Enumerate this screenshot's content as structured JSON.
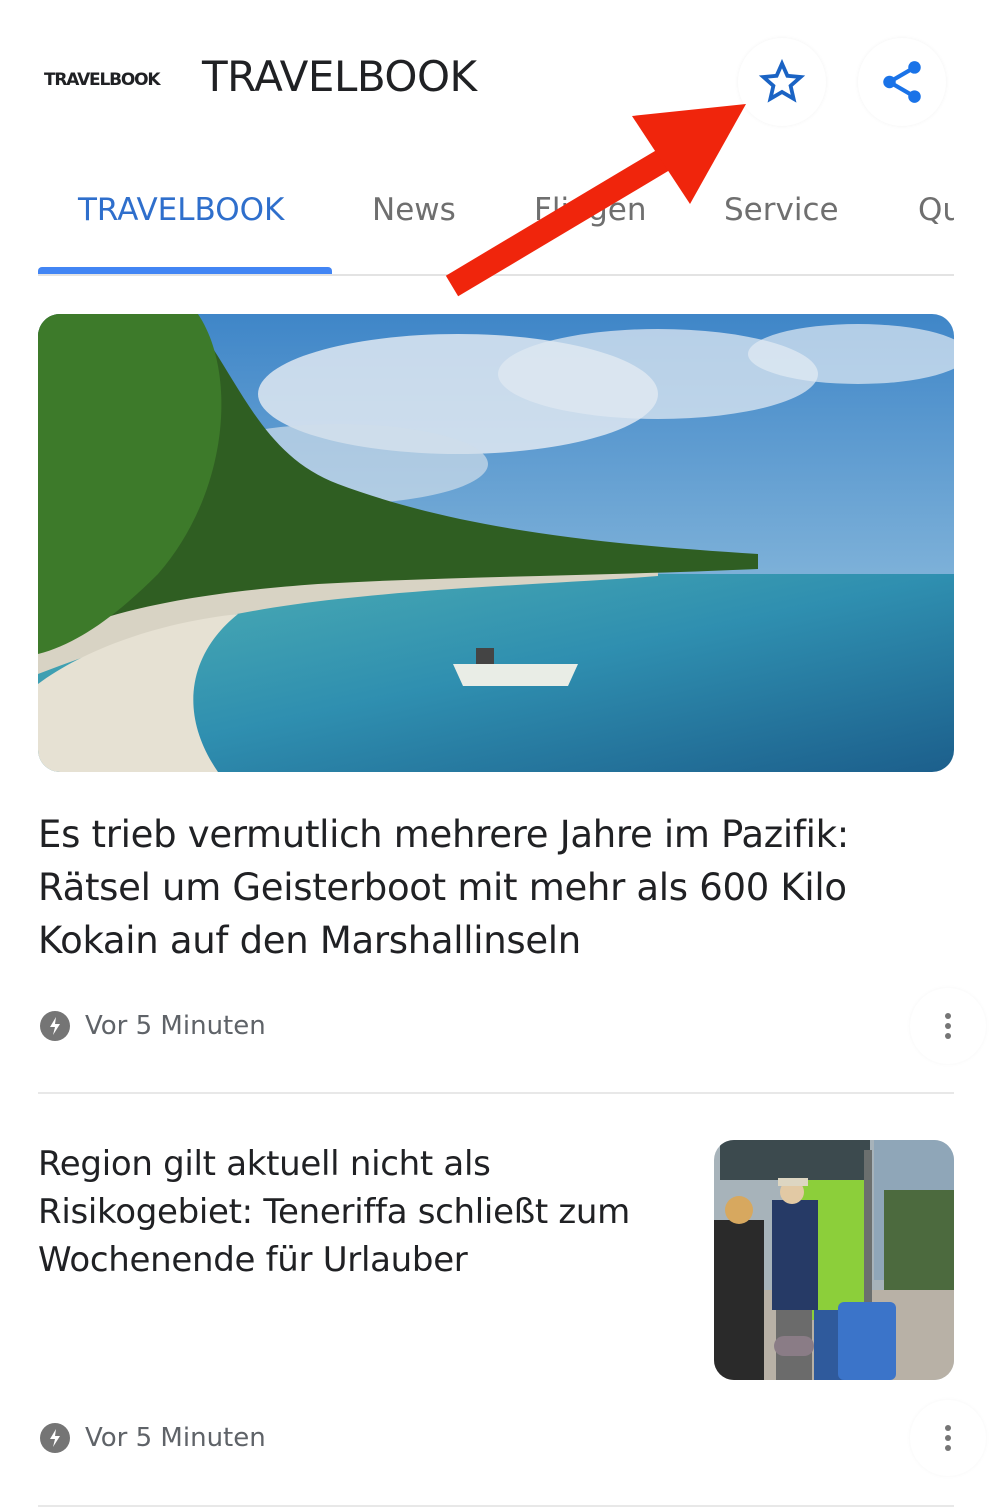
{
  "header": {
    "logo_text": "TRAVELBOOK",
    "title": "TRAVELBOOK",
    "star_icon": "star-outline-icon",
    "share_icon": "share-icon",
    "accent_color": "#1a73e8"
  },
  "tabs": [
    {
      "label": "TRAVELBOOK",
      "active": true
    },
    {
      "label": "News",
      "active": false
    },
    {
      "label": "Fliegen",
      "active": false
    },
    {
      "label": "Service",
      "active": false
    },
    {
      "label": "Qu",
      "active": false
    }
  ],
  "articles": [
    {
      "image": "beach-island-boat-image",
      "headline": "Es trieb vermutlich mehrere Jahre im Pazifik: Rätsel um Geisterboot mit mehr als 600 Kilo Kokain auf den Marshallinseln",
      "time": "Vor 5 Minuten",
      "time_icon": "bolt-icon",
      "more_icon": "more-vert-icon"
    },
    {
      "image": "travelers-luggage-ticket-booth-image",
      "headline": "Region gilt aktuell nicht als Risikogebiet: Teneriffa schließt zum Wochenende für Urlauber",
      "time": "Vor 5 Minuten",
      "time_icon": "bolt-icon",
      "more_icon": "more-vert-icon"
    }
  ],
  "annotation": {
    "arrow_color": "#f0250c",
    "points_to": "star-button"
  }
}
